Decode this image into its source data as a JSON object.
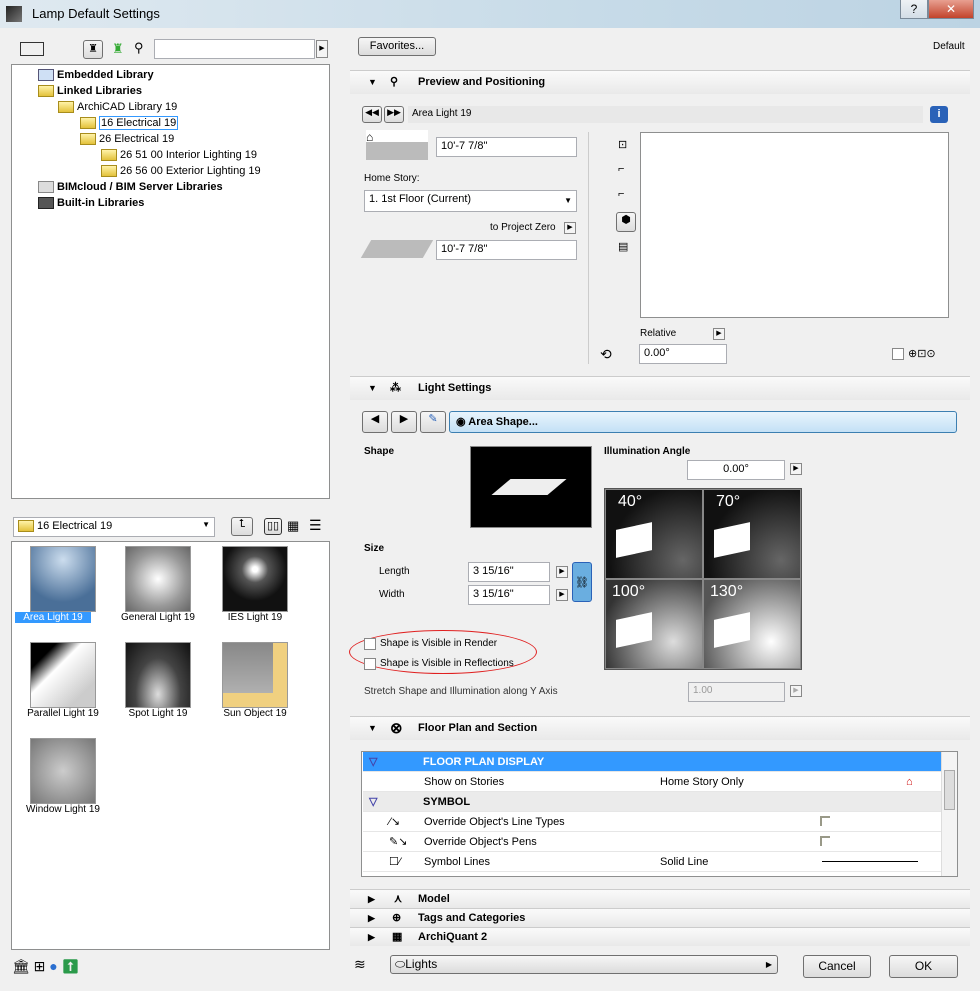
{
  "window": {
    "title": "Lamp Default Settings",
    "help": "?",
    "close": "✕"
  },
  "left": {
    "tree": [
      {
        "label": "Embedded Library",
        "bold": true
      },
      {
        "label": "Linked Libraries",
        "bold": true
      },
      {
        "label": "ArchiCAD Library 19"
      },
      {
        "label": "16 Electrical 19"
      },
      {
        "label": "26 Electrical 19"
      },
      {
        "label": "26 51 00 Interior Lighting 19"
      },
      {
        "label": "26 56 00 Exterior Lighting 19"
      },
      {
        "label": "BIMcloud / BIM Server Libraries",
        "bold": true
      },
      {
        "label": "Built-in Libraries",
        "bold": true
      }
    ],
    "folder_select": "16 Electrical 19",
    "items": [
      "Area Light 19",
      "General Light 19",
      "IES Light 19",
      "Parallel Light 19",
      "Spot Light 19",
      "Sun Object 19",
      "Window Light 19"
    ]
  },
  "right": {
    "favorites": "Favorites...",
    "default_label": "Default",
    "preview": {
      "title": "Preview and Positioning",
      "object_name": "Area Light 19",
      "height_top": "10'-7 7/8\"",
      "home_story_label": "Home Story:",
      "home_story": "1. 1st Floor (Current)",
      "to_project_zero": "to Project Zero",
      "height_bottom": "10'-7 7/8\"",
      "relative_label": "Relative",
      "angle": "0.00°"
    },
    "light": {
      "title": "Light Settings",
      "shape_button": "Area Shape...",
      "shape_label": "Shape",
      "size_label": "Size",
      "length_label": "Length",
      "length": "3 15/16\"",
      "width_label": "Width",
      "width": "3 15/16\"",
      "illum_label": "Illumination Angle",
      "illum_value": "0.00°",
      "angles": [
        "40°",
        "70°",
        "100°",
        "130°"
      ],
      "visible_render": "Shape is Visible in Render",
      "visible_reflections": "Shape is Visible in Reflections",
      "stretch_label": "Stretch Shape and Illumination along Y Axis",
      "stretch_value": "1.00"
    },
    "floorplan": {
      "title": "Floor Plan and Section",
      "rows": [
        {
          "name": "FLOOR PLAN DISPLAY",
          "value": ""
        },
        {
          "name": "Show on Stories",
          "value": "Home Story Only"
        },
        {
          "name": "SYMBOL",
          "value": ""
        },
        {
          "name": "Override Object's Line Types",
          "value": ""
        },
        {
          "name": "Override Object's Pens",
          "value": ""
        },
        {
          "name": "Symbol Lines",
          "value": "Solid Line"
        }
      ]
    },
    "collapsed": [
      "Model",
      "Tags and Categories",
      "ArchiQuant 2"
    ],
    "layer": "Lights",
    "cancel": "Cancel",
    "ok": "OK"
  },
  "colors": {
    "accent": "#3399ff",
    "annotation": "#e02020"
  }
}
